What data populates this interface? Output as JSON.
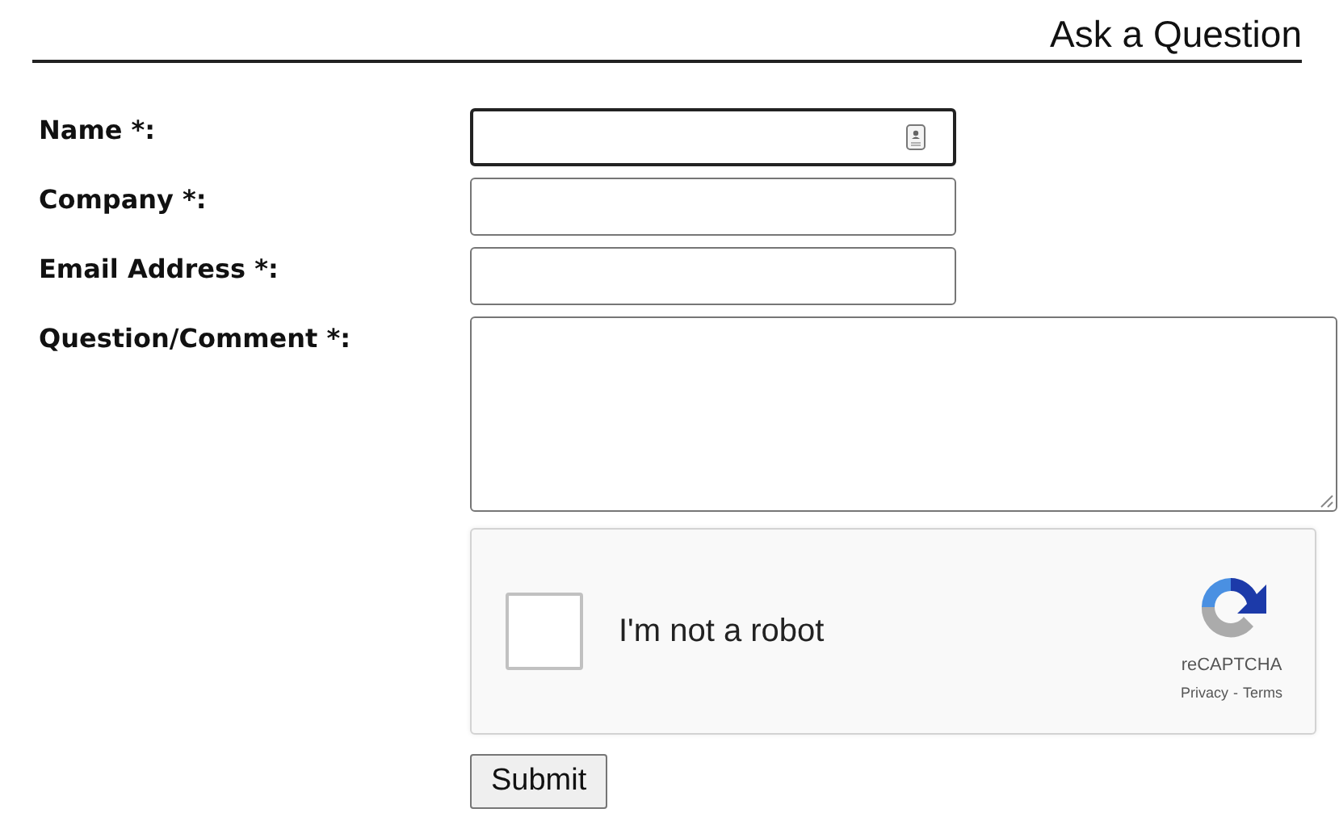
{
  "heading": "Ask a Question",
  "fields": [
    {
      "label": "Name *:",
      "kind": "text",
      "focused": true
    },
    {
      "label": "Company *:",
      "kind": "text",
      "focused": false
    },
    {
      "label": "Email Address *:",
      "kind": "text",
      "focused": false
    },
    {
      "label": "Question/Comment *:",
      "kind": "textarea",
      "focused": false
    }
  ],
  "captcha": {
    "label": "I'm not a robot",
    "checked": false,
    "brand": "reCAPTCHA",
    "privacy": "Privacy",
    "separator": "-",
    "terms": "Terms"
  },
  "submit": "Submit"
}
